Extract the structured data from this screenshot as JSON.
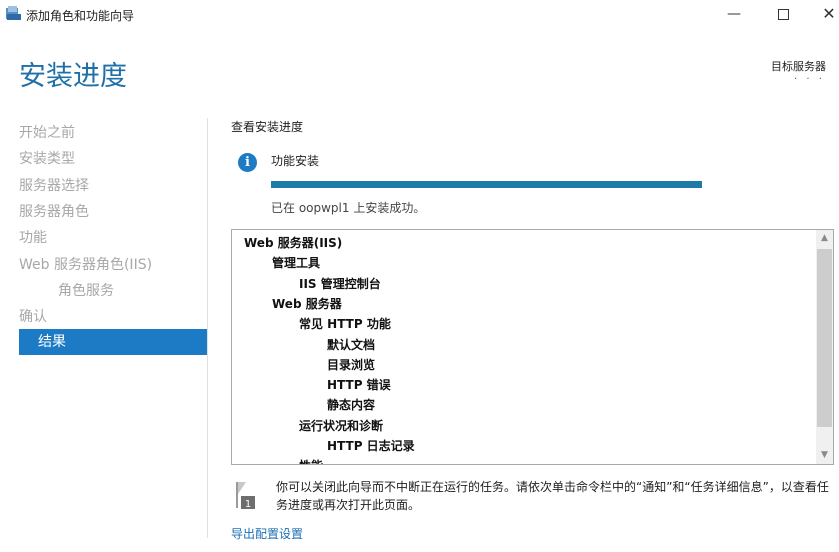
{
  "window": {
    "title": "添加角色和功能向导",
    "minimize_glyph": "—",
    "close_glyph": "✕"
  },
  "header": {
    "page_title": "安装进度",
    "target_label": "目标服务器",
    "target_value": "· · ·"
  },
  "sidebar": {
    "items": [
      {
        "label": "开始之前"
      },
      {
        "label": "安装类型"
      },
      {
        "label": "服务器选择"
      },
      {
        "label": "服务器角色"
      },
      {
        "label": "功能"
      },
      {
        "label": "Web 服务器角色(IIS)"
      },
      {
        "label": "角色服务"
      },
      {
        "label": "确认"
      },
      {
        "label": "结果"
      }
    ]
  },
  "main": {
    "heading": "查看安装进度",
    "info_glyph": "i",
    "feature_install": "功能安装",
    "progress": 1.0,
    "status": "已在 oopwpl1 上安装成功。",
    "tree": [
      {
        "label": "Web 服务器(IIS)",
        "level": 0
      },
      {
        "label": "管理工具",
        "level": 1
      },
      {
        "label": "IIS 管理控制台",
        "level": 2
      },
      {
        "label": "Web 服务器",
        "level": 1
      },
      {
        "label": "常见 HTTP 功能",
        "level": 2
      },
      {
        "label": "默认文档",
        "level": 3
      },
      {
        "label": "目录浏览",
        "level": 3
      },
      {
        "label": "HTTP 错误",
        "level": 3
      },
      {
        "label": "静态内容",
        "level": 3
      },
      {
        "label": "运行状况和诊断",
        "level": 2
      },
      {
        "label": "HTTP 日志记录",
        "level": 3
      },
      {
        "label": "性能",
        "level": 2
      }
    ],
    "note": "你可以关闭此向导而不中断正在运行的任务。请依次单击命令栏中的“通知”和“任务详细信息”，以查看任务进度或再次打开此页面。",
    "flag_badge": "1",
    "export_link": "导出配置设置"
  },
  "colors": {
    "accent": "#1c7bc4",
    "title": "#1f6fa8",
    "progress": "#1e7aa6",
    "link": "#1c6fb3"
  }
}
